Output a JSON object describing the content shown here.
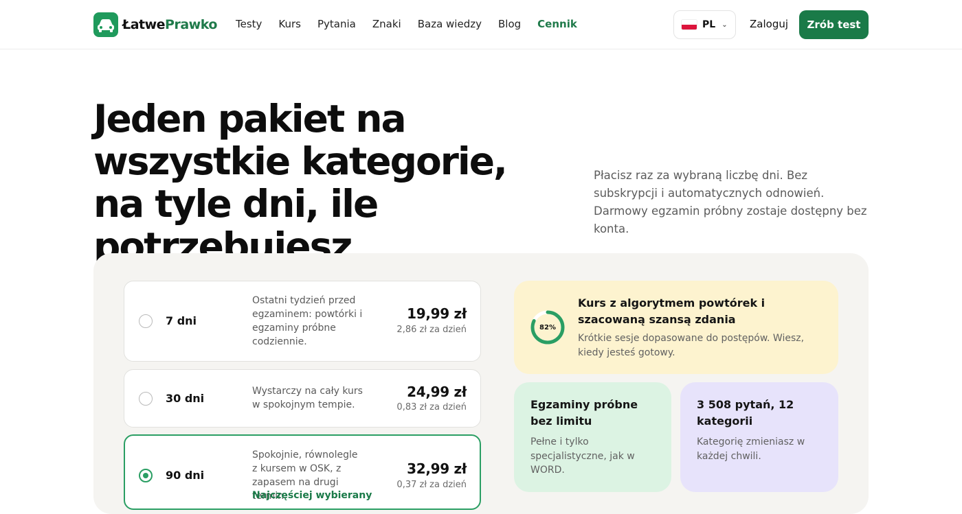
{
  "brand": {
    "part1": "Łatwe",
    "part2": "Prawko"
  },
  "nav": [
    "Testy",
    "Kurs",
    "Pytania",
    "Znaki",
    "Baza wiedzy",
    "Blog",
    "Cennik"
  ],
  "nav_active": "Cennik",
  "language": {
    "code": "PL"
  },
  "header": {
    "login_label": "Zaloguj",
    "cta_label": "Zrób test"
  },
  "hero": {
    "title": "Jeden pakiet na wszystkie kategorie, na tyle dni, ile potrzebujesz",
    "subtitle": "Płacisz raz za wybraną liczbę dni. Bez subskrypcji i automatycznych odnowień. Darmowy egzamin próbny zostaje dostępny bez konta."
  },
  "plans": [
    {
      "name": "7 dni",
      "description": "Ostatni tydzień przed egzaminem: powtórki i egzaminy próbne codziennie.",
      "price": "19,99 zł",
      "per_day": "2,86 zł za dzień",
      "selected": false
    },
    {
      "name": "30 dni",
      "description": "Wystarczy na cały kurs w spokojnym tempie.",
      "price": "24,99 zł",
      "per_day": "0,83 zł za dzień",
      "selected": false
    },
    {
      "name": "90 dni",
      "description": "Spokojnie, równolegle z kursem w OSK, z zapasem na drugi termin.",
      "price": "32,99 zł",
      "per_day": "0,37 zł za dzień",
      "selected": true,
      "tag": "Najczęściej wybierany"
    }
  ],
  "features": {
    "course": {
      "title": "Kurs z algorytmem powtórek i szacowaną szansą zdania",
      "text": "Krótkie sesje dopasowane do postępów. Wiesz, kiedy jesteś gotowy.",
      "progress_label": "82%",
      "progress": 0.82
    },
    "exams": {
      "title": "Egzaminy próbne bez limitu",
      "text": "Pełne i tylko specjalistyczne, jak w WORD."
    },
    "questions": {
      "title": "3 508 pytań, 12 kategorii",
      "text": "Kategorię zmieniasz w każdej chwili."
    }
  },
  "colors": {
    "brand_green": "#1a7a48",
    "accent_green": "#2a9e63",
    "yellow_card": "#fdf3cf",
    "green_card": "#dcf3e3",
    "purple_card": "#e7e3fb"
  }
}
